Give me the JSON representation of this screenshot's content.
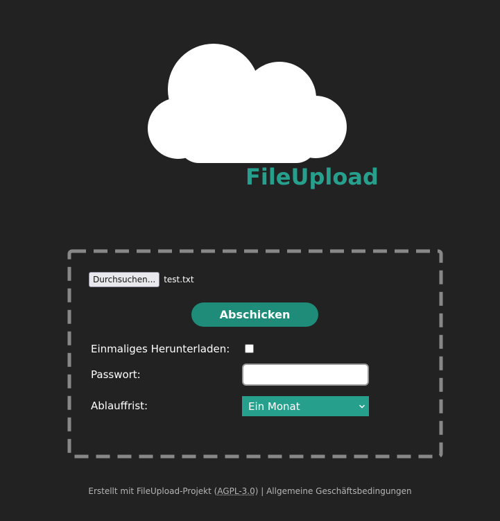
{
  "header": {
    "logo_icon": "cloud-icon",
    "logo_text": "FileUpload"
  },
  "form": {
    "browse_label": "Durchsuchen...",
    "file_name": "test.txt",
    "submit_label": "Abschicken",
    "once_download_label": "Einmaliges Herunterladen:",
    "once_download_checked": false,
    "password_label": "Passwort:",
    "password_value": "",
    "expiry_label": "Ablauffrist:",
    "expiry_selected": "Ein Monat"
  },
  "footer": {
    "prefix": "Erstellt mit FileUpload-Projekt (",
    "license": "AGPL-3.0",
    "middle": ") | ",
    "terms": "Allgemeine Geschäftsbedingungen"
  },
  "colors": {
    "background": "#222222",
    "accent": "#26a08d",
    "button": "#1f8b79",
    "border_dash": "#888888"
  }
}
